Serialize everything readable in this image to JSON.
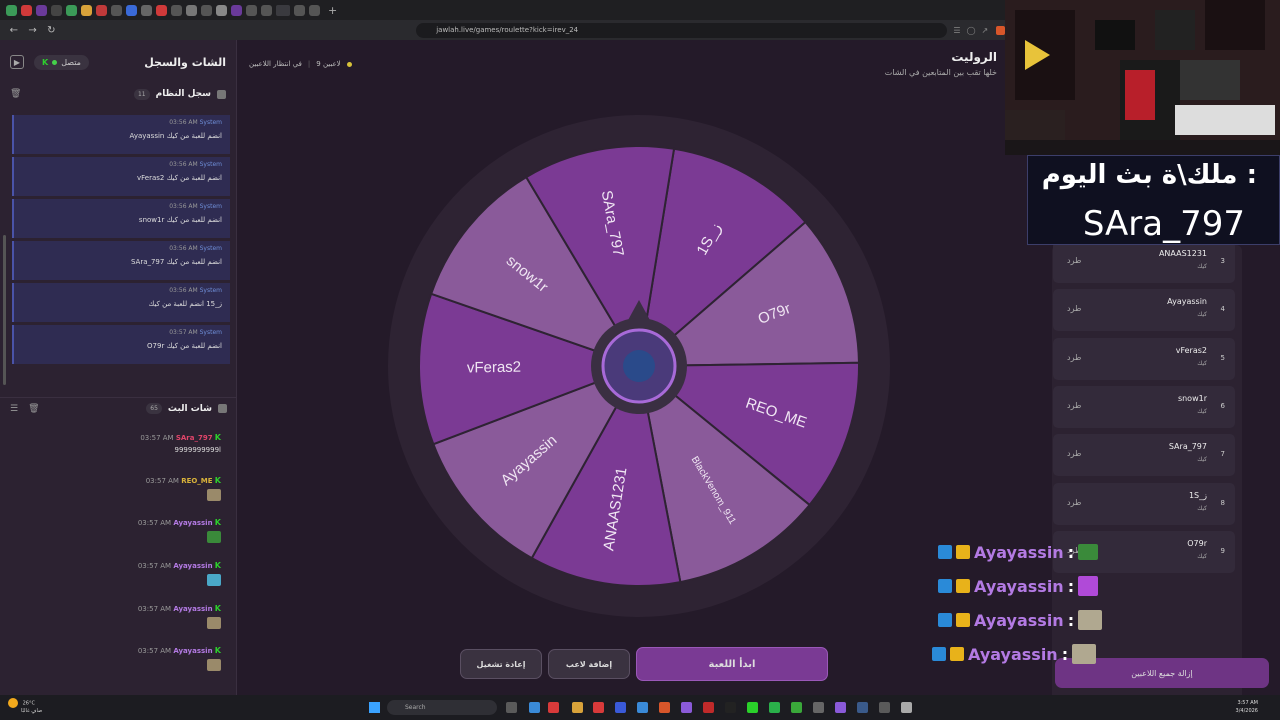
{
  "browser": {
    "url": "jawlah.live/games/roulette?kick=irev_24"
  },
  "sidebar": {
    "title": "الشات والسجل",
    "status": "متصل",
    "kick_label": "K",
    "system_log": {
      "title": "سجل النظام",
      "count": "11",
      "items": [
        {
          "name": "System",
          "time": "03:56 AM",
          "msg": "Ayayassin انضم للعبة من كيك"
        },
        {
          "name": "System",
          "time": "03:56 AM",
          "msg": "vFeras2 انضم للعبة من كيك"
        },
        {
          "name": "System",
          "time": "03:56 AM",
          "msg": "snow1r انضم للعبة من كيك"
        },
        {
          "name": "System",
          "time": "03:56 AM",
          "msg": "SAra_797 انضم للعبة من كيك"
        },
        {
          "name": "System",
          "time": "03:56 AM",
          "msg": "ز_15 انضم للعبة من كيك"
        },
        {
          "name": "System",
          "time": "03:57 AM",
          "msg": "O79r انضم للعبة من كيك"
        }
      ]
    },
    "stream_chat": {
      "title": "شات البث",
      "count": "65",
      "items": [
        {
          "user": "SAra_797",
          "time": "03:57 AM",
          "msg": "9999999999ا",
          "color": "#e0456a"
        },
        {
          "user": "REO_ME",
          "time": "03:57 AM",
          "msg": "",
          "color": "#d8b23a"
        },
        {
          "user": "Ayayassin",
          "time": "03:57 AM",
          "msg": "",
          "color": "#b37ae3"
        },
        {
          "user": "Ayayassin",
          "time": "03:57 AM",
          "msg": "",
          "color": "#b37ae3"
        },
        {
          "user": "Ayayassin",
          "time": "03:57 AM",
          "msg": "",
          "color": "#b37ae3"
        },
        {
          "user": "Ayayassin",
          "time": "03:57 AM",
          "msg": "",
          "color": "#b37ae3"
        }
      ]
    }
  },
  "game": {
    "title": "الروليت",
    "subtitle": "خلها تقب بين المتابعين في الشات",
    "players_count": "9 لاعبين",
    "waiting": "في انتظار اللاعبين",
    "wheel_names": [
      "1S_ز",
      "O79r",
      "REO_ME",
      "BlackVenom_911",
      "ANAAS1231",
      "Ayayassin",
      "vFeras2",
      "snow1r",
      "SAra_797"
    ],
    "colors": {
      "dark": "#7b3a94",
      "light": "#8a5a9a"
    },
    "buttons": {
      "start": "ابدأ اللعبة",
      "add_player": "إضافة لاعب",
      "restart": "إعادة تشغيل",
      "remove_all": "إزالة جميع اللاعبين"
    },
    "kick_word": "طرد",
    "platform": "كيك",
    "players": [
      {
        "num": "3",
        "name": "ANAAS1231"
      },
      {
        "num": "4",
        "name": "Ayayassin"
      },
      {
        "num": "5",
        "name": "vFeras2"
      },
      {
        "num": "6",
        "name": "snow1r"
      },
      {
        "num": "7",
        "name": "SAra_797"
      },
      {
        "num": "8",
        "name": "1S_ز"
      },
      {
        "num": "9",
        "name": "O79r"
      }
    ]
  },
  "stream_overlay": {
    "king_title": "ملك\\ة بث اليوم :",
    "king_name": "SAra_797",
    "chat": [
      {
        "user": "Ayayassin",
        "sep": ":"
      },
      {
        "user": "Ayayassin",
        "sep": ":"
      },
      {
        "user": "Ayayassin",
        "sep": ":"
      },
      {
        "user": "Ayayassin",
        "sep": ":"
      }
    ]
  },
  "taskbar": {
    "weather_temp": "26°C",
    "weather_desc": "صافٍ غالبًا",
    "search": "Search",
    "time": "3:57 AM",
    "date": "3/4/2026"
  }
}
